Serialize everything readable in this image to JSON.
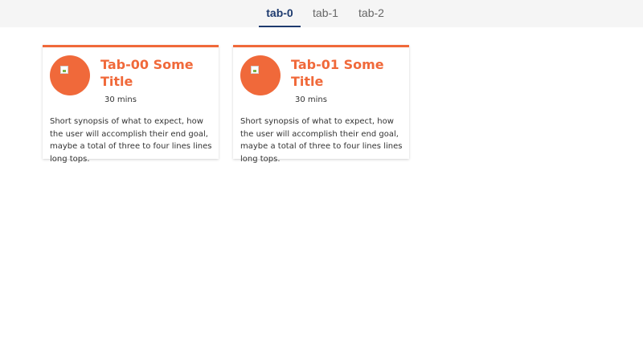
{
  "tabs": [
    {
      "label": "tab-0",
      "active": true
    },
    {
      "label": "tab-1",
      "active": false
    },
    {
      "label": "tab-2",
      "active": false
    }
  ],
  "colors": {
    "accent": "#f0693a",
    "active_tab": "#1d3a6e",
    "tabbar_bg": "#f5f5f5"
  },
  "cards": [
    {
      "title": "Tab-00 Some Title",
      "duration": "30 mins",
      "synopsis": "Short synopsis of what to expect, how the user will accomplish their end goal, maybe a total of three to four lines lines long tops.",
      "icon": "broken-image-icon"
    },
    {
      "title": "Tab-01 Some Title",
      "duration": "30 mins",
      "synopsis": "Short synopsis of what to expect, how the user will accomplish their end goal, maybe a total of three to four lines lines long tops.",
      "icon": "broken-image-icon"
    }
  ]
}
